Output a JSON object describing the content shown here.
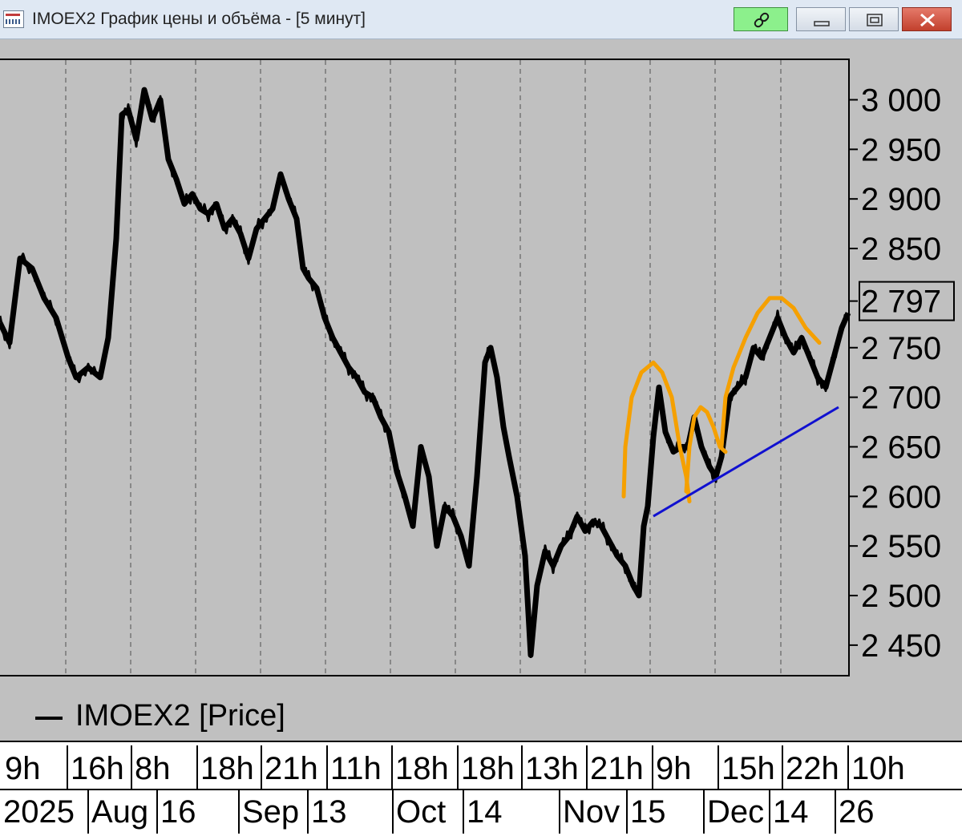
{
  "window": {
    "title": "IMOEX2 График цены и объёма - [5 минут]"
  },
  "legend": {
    "label": "IMOEX2 [Price]"
  },
  "colors": {
    "background": "#c0c0c0",
    "price_line": "#000000",
    "annotation_arcs": "#f5a000",
    "trend_line": "#1010d0",
    "link_button": "#8cf08c",
    "close_button": "#d0503c"
  },
  "chart_data": {
    "type": "line",
    "series": [
      {
        "name": "IMOEX2 [Price]",
        "x": [
          0,
          12,
          25,
          40,
          55,
          70,
          85,
          95,
          110,
          125,
          135,
          145,
          152,
          160,
          170,
          180,
          190,
          200,
          210,
          220,
          230,
          240,
          250,
          260,
          270,
          280,
          290,
          300,
          310,
          320,
          330,
          340,
          350,
          360,
          370,
          378,
          385,
          395,
          405,
          415,
          425,
          435,
          445,
          455,
          465,
          475,
          485,
          495,
          505,
          515,
          525,
          535,
          545,
          555,
          565,
          575,
          585,
          595,
          605,
          612,
          620,
          628,
          635,
          645,
          655,
          662,
          670,
          680,
          690,
          700,
          710,
          720,
          730,
          740,
          750,
          760,
          770,
          780,
          790,
          797,
          803,
          808,
          815,
          822,
          830,
          840,
          850,
          858,
          866,
          875,
          885,
          893,
          900,
          910,
          920,
          930,
          940,
          950,
          960,
          970,
          980,
          990,
          1000,
          1010,
          1020,
          1030,
          1040,
          1050,
          1058
        ],
        "values": [
          2775,
          2755,
          2840,
          2830,
          2800,
          2780,
          2740,
          2720,
          2730,
          2720,
          2760,
          2860,
          2985,
          2990,
          2960,
          3010,
          2980,
          3000,
          2940,
          2920,
          2895,
          2905,
          2890,
          2885,
          2895,
          2870,
          2880,
          2865,
          2840,
          2870,
          2880,
          2890,
          2925,
          2900,
          2880,
          2830,
          2820,
          2810,
          2780,
          2760,
          2745,
          2730,
          2720,
          2705,
          2700,
          2680,
          2665,
          2625,
          2600,
          2570,
          2650,
          2620,
          2550,
          2590,
          2580,
          2560,
          2530,
          2620,
          2735,
          2750,
          2720,
          2670,
          2640,
          2600,
          2540,
          2440,
          2510,
          2545,
          2530,
          2550,
          2560,
          2580,
          2565,
          2575,
          2570,
          2555,
          2540,
          2530,
          2510,
          2500,
          2570,
          2590,
          2660,
          2710,
          2665,
          2645,
          2650,
          2650,
          2680,
          2650,
          2630,
          2620,
          2640,
          2700,
          2710,
          2720,
          2750,
          2740,
          2760,
          2780,
          2760,
          2745,
          2760,
          2740,
          2720,
          2710,
          2740,
          2770,
          2785
        ]
      }
    ],
    "annotations": {
      "arcs": [
        {
          "x": [
            778,
            780,
            788,
            800,
            815,
            826,
            838,
            848,
            856,
            860
          ],
          "values": [
            2600,
            2650,
            2700,
            2725,
            2735,
            2725,
            2700,
            2650,
            2620,
            2595
          ]
        },
        {
          "x": [
            856,
            860,
            866,
            874,
            882,
            890,
            898,
            905
          ],
          "values": [
            2605,
            2650,
            2680,
            2690,
            2685,
            2670,
            2650,
            2645
          ]
        },
        {
          "x": [
            900,
            905,
            915,
            930,
            945,
            960,
            975,
            990,
            1005,
            1022
          ],
          "values": [
            2650,
            2700,
            2730,
            2760,
            2785,
            2800,
            2800,
            2790,
            2770,
            2755
          ]
        }
      ],
      "trend_line": {
        "x": [
          815,
          1046
        ],
        "values": [
          2580,
          2690
        ]
      }
    },
    "y_ticks": [
      "3 000",
      "2 950",
      "2 900",
      "2 850",
      "2 797",
      "2 750",
      "2 700",
      "2 650",
      "2 600",
      "2 550",
      "2 500",
      "2 450"
    ],
    "y_tick_values": [
      3000,
      2950,
      2900,
      2850,
      2797,
      2750,
      2700,
      2650,
      2600,
      2550,
      2500,
      2450
    ],
    "y_highlight": "2 797",
    "ylim": [
      2420,
      3040
    ],
    "x_ticks_top": [
      "9h",
      "16h",
      "8h",
      "18h",
      "21h",
      "11h",
      "18h",
      "18h",
      "13h",
      "21h",
      "9h",
      "15h",
      "22h",
      "10h"
    ],
    "x_ticks_bottom": [
      "2025",
      "Aug",
      "16",
      "Sep",
      "13",
      "Oct",
      "14",
      "Nov",
      "15",
      "Dec",
      "14",
      "26"
    ],
    "grid": "vertical dashed"
  }
}
